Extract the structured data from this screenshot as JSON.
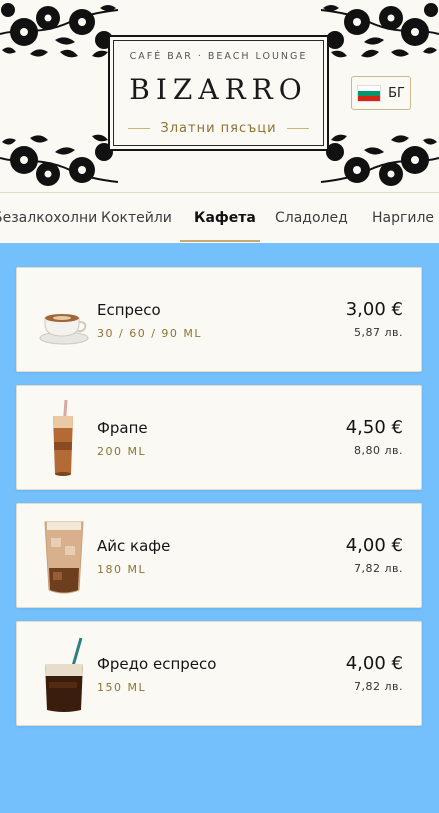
{
  "header": {
    "tagline": "CAFÉ BAR · BEACH LOUNGE",
    "brand": "BIZARRO",
    "location": "Златни пясъци",
    "language": {
      "label": "БГ",
      "flag_colors": [
        "#ffffff",
        "#00966e",
        "#d62612"
      ]
    }
  },
  "tabs": [
    {
      "label": "Безалкохолни"
    },
    {
      "label": "Коктейли"
    },
    {
      "label": "Кафета"
    },
    {
      "label": "Сладолед"
    },
    {
      "label": "Наргиле"
    }
  ],
  "active_tab": "Кафета",
  "colors": {
    "page_bg": "#74c0fc",
    "header_bg": "#fbf9f4",
    "accent_gold": "#8c7435",
    "underline": "#c9a96e"
  },
  "products": [
    {
      "name": "Еспресо",
      "size": "30 / 60 / 90 ML",
      "price_eur": "3,00 €",
      "price_bgn": "5,87 лв.",
      "image": "espresso-cup-image"
    },
    {
      "name": "Фрапе",
      "size": "200 ML",
      "price_eur": "4,50 €",
      "price_bgn": "8,80 лв.",
      "image": "frappe-glass-image"
    },
    {
      "name": "Айс кафе",
      "size": "180 ML",
      "price_eur": "4,00 €",
      "price_bgn": "7,82 лв.",
      "image": "iced-coffee-glass-image"
    },
    {
      "name": "Фредо еспресо",
      "size": "150 ML",
      "price_eur": "4,00 €",
      "price_bgn": "7,82 лв.",
      "image": "freddo-espresso-glass-image"
    }
  ]
}
